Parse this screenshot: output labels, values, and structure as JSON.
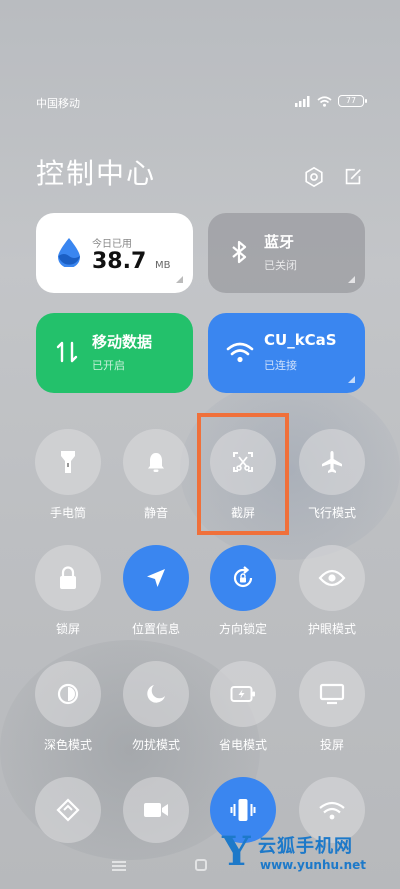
{
  "status_bar": {
    "carrier": "中国移动",
    "battery": "77"
  },
  "header": {
    "title": "控制中心"
  },
  "tiles": {
    "data_usage": {
      "caption": "今日已用",
      "value": "38.7",
      "unit": "MB"
    },
    "bluetooth": {
      "label": "蓝牙",
      "status": "已关闭"
    },
    "mobile_data": {
      "label": "移动数据",
      "status": "已开启"
    },
    "wifi": {
      "label": "CU_kCaS",
      "status": "已连接"
    }
  },
  "toggles": [
    {
      "label": "手电筒",
      "icon": "flashlight-icon",
      "on": false
    },
    {
      "label": "静音",
      "icon": "bell-icon",
      "on": false
    },
    {
      "label": "截屏",
      "icon": "screenshot-icon",
      "on": false
    },
    {
      "label": "飞行模式",
      "icon": "airplane-icon",
      "on": false
    },
    {
      "label": "锁屏",
      "icon": "lock-icon",
      "on": false
    },
    {
      "label": "位置信息",
      "icon": "location-icon",
      "on": true
    },
    {
      "label": "方向锁定",
      "icon": "rotation-lock-icon",
      "on": true
    },
    {
      "label": "护眼模式",
      "icon": "eye-icon",
      "on": false
    },
    {
      "label": "深色模式",
      "icon": "dark-mode-icon",
      "on": false
    },
    {
      "label": "勿扰模式",
      "icon": "moon-icon",
      "on": false
    },
    {
      "label": "省电模式",
      "icon": "battery-saver-icon",
      "on": false
    },
    {
      "label": "投屏",
      "icon": "cast-screen-icon",
      "on": false
    },
    {
      "label": "",
      "icon": "link-icon",
      "on": false
    },
    {
      "label": "",
      "icon": "video-icon",
      "on": false
    },
    {
      "label": "",
      "icon": "vibrate-icon",
      "on": true
    },
    {
      "label": "",
      "icon": "wifi-hotspot-icon",
      "on": false
    }
  ],
  "colors": {
    "accent_blue": "#3a86f0",
    "mobile_green": "#23c16b",
    "highlight_orange": "#f0703a"
  },
  "watermark": {
    "letter": "Y",
    "name": "云狐手机网",
    "url": "www.yunhu.net"
  }
}
